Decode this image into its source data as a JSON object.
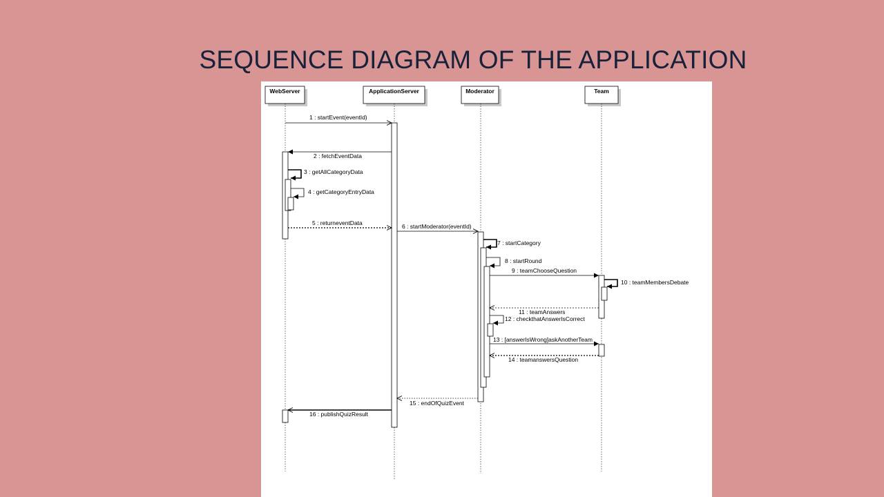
{
  "slide": {
    "title": "SEQUENCE DIAGRAM OF THE APPLICATION",
    "colors": {
      "background": "#d99594",
      "title": "#17213a",
      "panel": "#ffffff"
    }
  },
  "diagram": {
    "participants": [
      "WebServer",
      "ApplicationServer",
      "Moderator",
      "Team"
    ],
    "messages": [
      {
        "from": "WebServer",
        "to": "ApplicationServer",
        "label": "1 : startEvent(eventId)",
        "kind": "async"
      },
      {
        "from": "ApplicationServer",
        "to": "WebServer",
        "label": "2 : fetchEventData",
        "kind": "sync"
      },
      {
        "from": "WebServer",
        "to": "WebServer",
        "label": "3 : getAllCategoryData",
        "kind": "self"
      },
      {
        "from": "WebServer",
        "to": "WebServer",
        "label": "4 : getCategoryEntryData",
        "kind": "self"
      },
      {
        "from": "WebServer",
        "to": "ApplicationServer",
        "label": "5 : returneventData",
        "kind": "return"
      },
      {
        "from": "ApplicationServer",
        "to": "Moderator",
        "label": "6 : startModerator(eventId)",
        "kind": "async"
      },
      {
        "from": "Moderator",
        "to": "Moderator",
        "label": "7 : startCategory",
        "kind": "self"
      },
      {
        "from": "Moderator",
        "to": "Moderator",
        "label": "8 : startRound",
        "kind": "self"
      },
      {
        "from": "Moderator",
        "to": "Team",
        "label": "9 : teamChooseQuestion",
        "kind": "sync"
      },
      {
        "from": "Team",
        "to": "Team",
        "label": "10 : teamMembersDebate",
        "kind": "self"
      },
      {
        "from": "Team",
        "to": "Moderator",
        "label": "11 : teamAnswers",
        "kind": "return"
      },
      {
        "from": "Moderator",
        "to": "Moderator",
        "label": "12 : checkthatAnswerIsCorrect",
        "kind": "self"
      },
      {
        "from": "Moderator",
        "to": "Team",
        "label": "13 : [answerIsWrong]askAnotherTeam",
        "kind": "sync"
      },
      {
        "from": "Team",
        "to": "Moderator",
        "label": "14 : teamanswersQuestion",
        "kind": "return"
      },
      {
        "from": "Moderator",
        "to": "ApplicationServer",
        "label": "15 : endOfQuizEvent",
        "kind": "return"
      },
      {
        "from": "ApplicationServer",
        "to": "WebServer",
        "label": "16 : publishQuizResult",
        "kind": "sync"
      }
    ]
  }
}
